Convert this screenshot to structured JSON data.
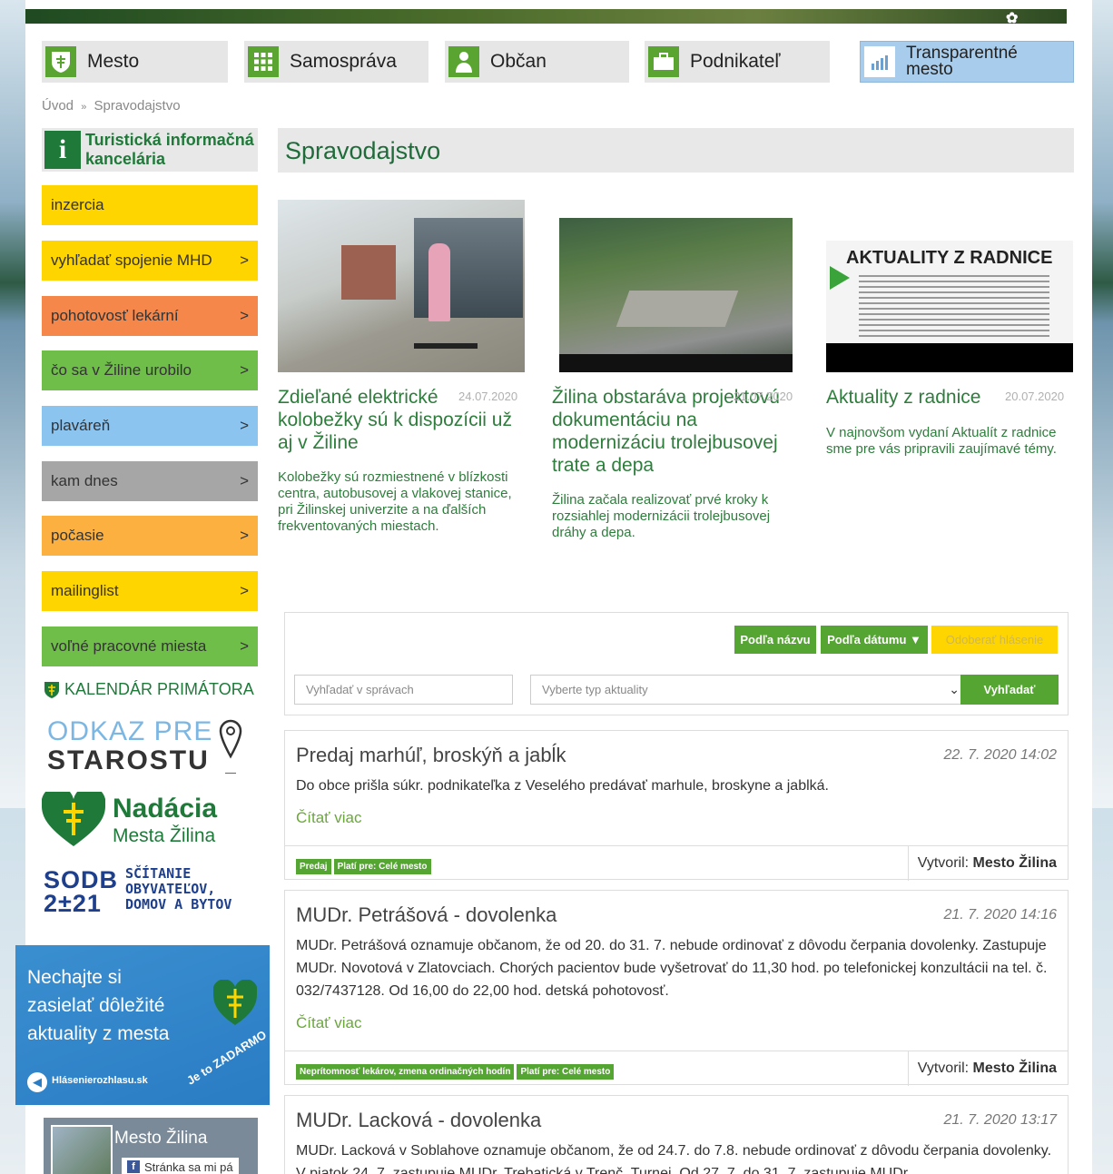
{
  "nav": [
    {
      "label": "Mesto",
      "icon": "shield-icon"
    },
    {
      "label": "Samospráva",
      "icon": "grid-icon"
    },
    {
      "label": "Občan",
      "icon": "person-icon"
    },
    {
      "label": "Podnikateľ",
      "icon": "briefcase-icon"
    },
    {
      "label": "Transparentné mesto",
      "icon": "chart-icon"
    }
  ],
  "breadcrumb": {
    "home": "Úvod",
    "sep": "»",
    "current": "Spravodajstvo"
  },
  "tourist": {
    "line1": "Turistická informačná",
    "line2": "kancelária"
  },
  "sidebar": [
    {
      "label": "inzercia",
      "color": "#ffd500",
      "chev": ""
    },
    {
      "label": "vyhľadať spojenie MHD",
      "color": "#ffd500",
      "chev": ">"
    },
    {
      "label": "pohotovosť lekární",
      "color": "#f5874a",
      "chev": ">"
    },
    {
      "label": "čo sa v Žiline urobilo",
      "color": "#6fbe4a",
      "chev": ">"
    },
    {
      "label": "plaváreň",
      "color": "#8cc4f0",
      "chev": ">"
    },
    {
      "label": "kam dnes",
      "color": "#a6a6a6",
      "chev": ">"
    },
    {
      "label": "počasie",
      "color": "#fbb040",
      "chev": ">"
    },
    {
      "label": "mailinglist",
      "color": "#ffd500",
      "chev": ">"
    },
    {
      "label": "voľné pracovné miesta",
      "color": "#6fbe4a",
      "chev": ">"
    }
  ],
  "kalendar": "KALENDÁR PRIMÁTORA",
  "odkaz": {
    "line1": "ODKAZ PRE",
    "line2": "STAROSTU"
  },
  "nadacia": {
    "line1": "Nadácia",
    "line2": "Mesta Žilina"
  },
  "sodb": {
    "logo1": "SODB",
    "logo2": "2±21",
    "line1": "SČÍTANIE",
    "line2": "OBYVATEĽOV,",
    "line3": "DOMOV A BYTOV"
  },
  "banner": {
    "line1": "Nechajte si",
    "line2": "zasielať dôležité",
    "line3": "aktuality z mesta",
    "brand": "Hlásenierozhlasu.sk",
    "slogan": "Je to ZADARMO"
  },
  "fb": {
    "title": "Mesto Žilina",
    "like": "Stránka sa mi pá"
  },
  "page_title": "Spravodajstvo",
  "cards": [
    {
      "title": "Zdieľané elektrické kolobežky sú k dispozícii už aj v Žiline",
      "date": "24.07.2020",
      "desc": "Kolobežky sú rozmiestnené v blízkosti centra, autobusovej a vlakovej stanice, pri Žilinskej univerzite a na ďalších frekventovaných miestach."
    },
    {
      "title": "Žilina obstaráva projektovú dokumentáciu na modernizáciu trolejbusovej trate a depa",
      "date": "21.07.2020",
      "desc": "Žilina začala realizovať prvé kroky k rozsiahlej modernizácii trolejbusovej dráhy a depa."
    },
    {
      "title": "Aktuality z radnice",
      "date": "20.07.2020",
      "desc": "V najnovšom vydaní Aktualít z radnice sme pre vás pripravili zaujímavé témy.",
      "img_heading": "AKTUALITY Z RADNICE"
    }
  ],
  "filter": {
    "sort_name": "Podľa názvu",
    "sort_date": "Podľa dátumu ▼",
    "subscribe": "Odoberať hlásenie",
    "search_placeholder": "Vyhľadať v správach",
    "type_placeholder": "Vyberte typ aktuality",
    "search_btn": "Vyhľadať"
  },
  "news": [
    {
      "title": "Predaj marhúľ, broskýň a jabĺk",
      "date": "22. 7. 2020 14:02",
      "body": "Do obce prišla súkr. podnikateľka z Veselého predávať marhule, broskyne a jablká.",
      "more": "Čítať viac",
      "tags": [
        "Predaj",
        "Platí pre: Celé mesto"
      ],
      "by_label": "Vytvoril:",
      "by": "Mesto Žilina"
    },
    {
      "title": "MUDr. Petrášová - dovolenka",
      "date": "21. 7. 2020 14:16",
      "body": "MUDr. Petrášová oznamuje občanom, že od 20. do 31. 7. nebude ordinovať z dôvodu čerpania dovolenky. Zastupuje MUDr. Novotová v Zlatovciach. Chorých pacientov bude vyšetrovať do 11,30 hod. po telefonickej konzultácii na tel. č. 032/7437128. Od 16,00 do 22,00 hod. detská pohotovosť.",
      "more": "Čítať viac",
      "tags": [
        "Neprítomnosť lekárov, zmena ordinačných hodín",
        "Platí pre: Celé mesto"
      ],
      "by_label": "Vytvoril:",
      "by": "Mesto Žilina"
    },
    {
      "title": "MUDr. Lacková - dovolenka",
      "date": "21. 7. 2020 13:17",
      "body": "MUDr. Lacková v Soblahove oznamuje občanom, že od 24.7. do 7.8. nebude ordinovať z dôvodu čerpania dovolenky. V piatok 24. 7. zastupuje MUDr. Trebatická v Trenč. Turnej. Od 27. 7. do 31. 7. zastupuje MUDr."
    }
  ]
}
